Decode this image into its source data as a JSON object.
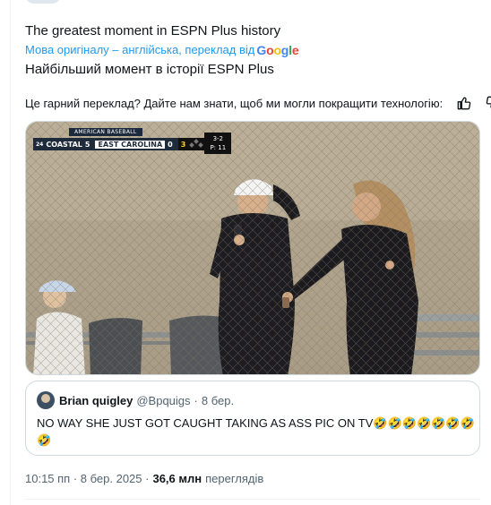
{
  "tweet": {
    "text": "The greatest moment in ESPN Plus history",
    "translation_label": "Мова оригіналу – англійська, переклад від",
    "translation_provider": "Google",
    "translated_text": "Найбільший момент в історії ESPN Plus",
    "feedback_question": "Це гарний переклад? Дайте нам знати, щоб ми могли покращити технологію:",
    "icons": {
      "thumbs_up": "thumbs-up-icon",
      "thumbs_down": "thumbs-down-icon"
    },
    "timestamp": "10:15 пп · 8 бер. 2025 ·",
    "views_count": "36,6 млн",
    "views_label": "переглядів"
  },
  "scorebug": {
    "league": "AMERICAN BASEBALL",
    "away_rank": "24",
    "away_team": "COASTAL",
    "away_score": "5",
    "home_team": "EAST CAROLINA",
    "home_score": "0",
    "inning": "3",
    "count": "3-2",
    "pitch": "P: 11"
  },
  "quoted_tweet": {
    "name": "Brian quigley",
    "handle": "@Bpquigs",
    "separator": "·",
    "date": "8 бер.",
    "text": "NO WAY SHE JUST GOT CAUGHT TAKING AS ASS PIC ON TV🤣🤣🤣🤣🤣🤣🤣🤣"
  },
  "colors": {
    "accent": "#1d9bf0",
    "text": "#0f1419",
    "secondary": "#536471",
    "border": "#cfd9de"
  }
}
